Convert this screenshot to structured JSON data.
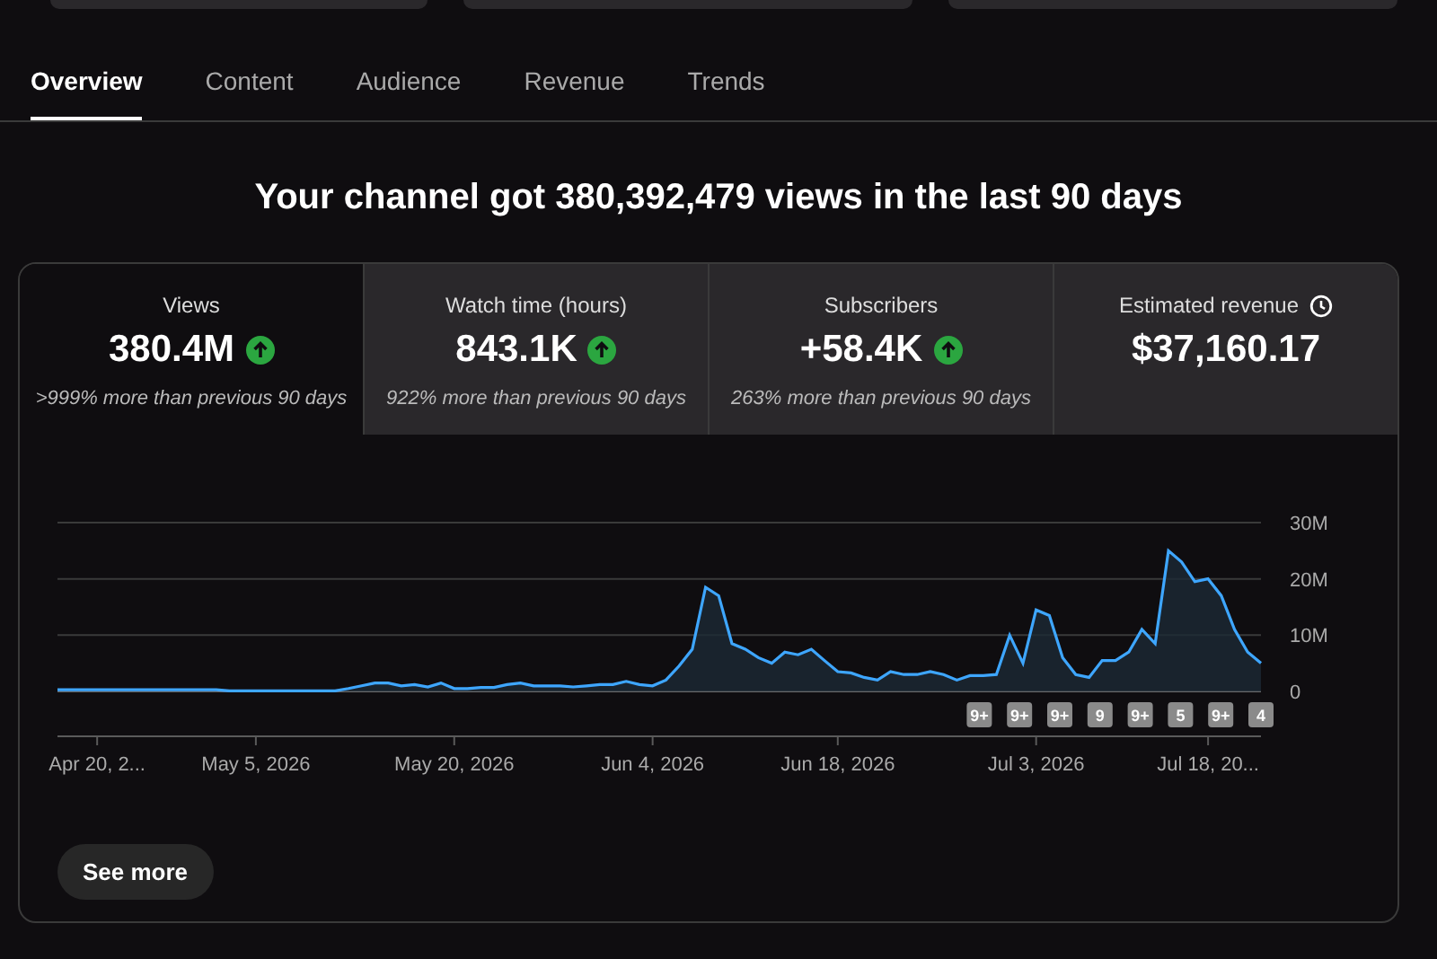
{
  "top_cards": [
    {
      "kind": "card"
    },
    {
      "kind": "card"
    },
    {
      "kind": "card"
    }
  ],
  "tabs": [
    {
      "label": "Overview",
      "selected": true
    },
    {
      "label": "Content",
      "selected": false
    },
    {
      "label": "Audience",
      "selected": false
    },
    {
      "label": "Revenue",
      "selected": false
    },
    {
      "label": "Trends",
      "selected": false
    }
  ],
  "headline": "Your channel got 380,392,479 views in the last 90 days",
  "metrics": [
    {
      "label": "Views",
      "value": "380.4M",
      "trend_up": true,
      "comparison": ">999% more than previous 90 days",
      "selected": true
    },
    {
      "label": "Watch time (hours)",
      "value": "843.1K",
      "trend_up": true,
      "comparison": "922% more than previous 90 days",
      "selected": false
    },
    {
      "label": "Subscribers",
      "value": "+58.4K",
      "trend_up": true,
      "comparison": "263% more than previous 90 days",
      "selected": false
    },
    {
      "label": "Estimated revenue",
      "value": "$37,160.17",
      "clock_icon": true,
      "selected": false
    }
  ],
  "chart": {
    "chart_data": {
      "type": "area",
      "ylim": [
        0,
        30
      ],
      "yticks": [
        {
          "value": 0,
          "label": "0"
        },
        {
          "value": 10,
          "label": "10M"
        },
        {
          "value": 20,
          "label": "20M"
        },
        {
          "value": 30,
          "label": "30M"
        }
      ],
      "categories": [
        null,
        null,
        null,
        "Apr 20, 2...",
        null,
        null,
        null,
        null,
        null,
        null,
        null,
        null,
        null,
        null,
        null,
        "May 5, 2026",
        null,
        null,
        null,
        null,
        null,
        null,
        null,
        null,
        null,
        null,
        null,
        null,
        null,
        null,
        "May 20, 2026",
        null,
        null,
        null,
        null,
        null,
        null,
        null,
        null,
        null,
        null,
        null,
        null,
        null,
        null,
        "Jun 4, 2026",
        null,
        null,
        null,
        null,
        null,
        null,
        null,
        null,
        null,
        null,
        null,
        null,
        null,
        "Jun 18, 2026",
        null,
        null,
        null,
        null,
        null,
        null,
        null,
        null,
        null,
        null,
        null,
        null,
        null,
        null,
        "Jul 3, 2026",
        null,
        null,
        null,
        null,
        null,
        null,
        null,
        null,
        null,
        null,
        null,
        null,
        "Jul 18, 20...",
        null,
        null,
        null,
        null
      ],
      "series": [
        {
          "color": "#3ea6ff",
          "values": [
            0.3,
            0.3,
            0.3,
            0.3,
            0.3,
            0.3,
            0.3,
            0.3,
            0.3,
            0.3,
            0.3,
            0.3,
            0.3,
            0.1,
            0.1,
            0.1,
            0.1,
            0.1,
            0.1,
            0.1,
            0.1,
            0.1,
            0.5,
            1,
            1.5,
            1.5,
            1,
            1.2,
            0.8,
            1.5,
            0.5,
            0.5,
            0.7,
            0.7,
            1.2,
            1.5,
            1,
            1,
            1,
            0.8,
            1,
            1.2,
            1.2,
            1.8,
            1.2,
            1,
            2,
            4.5,
            7.5,
            18.5,
            17,
            8.5,
            7.5,
            6,
            5,
            7,
            6.5,
            7.5,
            5.5,
            3.5,
            3.3,
            2.5,
            2,
            3.5,
            3,
            3,
            3.5,
            3,
            2,
            2.8,
            2.8,
            3,
            10,
            5,
            14.5,
            13.5,
            6,
            3,
            2.5,
            5.5,
            5.5,
            7,
            11,
            8.5,
            25,
            23,
            19.5,
            20,
            17,
            11,
            7,
            5
          ]
        }
      ]
    },
    "markers": [
      "9+",
      "9+",
      "9+",
      "9",
      "9+",
      "5",
      "9+",
      "4"
    ]
  },
  "see_more": "See more"
}
